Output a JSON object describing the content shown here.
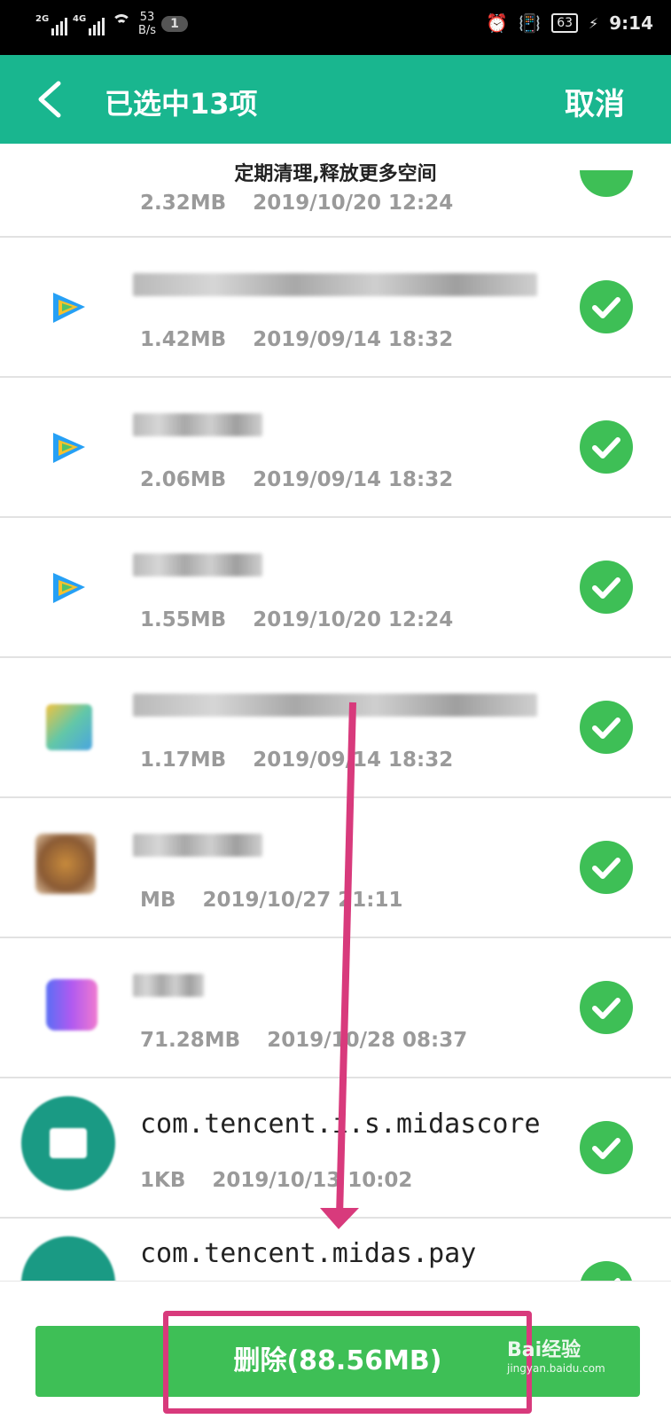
{
  "status_bar": {
    "net1": "2G",
    "net2": "4G",
    "speed_value": "53",
    "speed_unit": "B/s",
    "notification_count": "1",
    "battery": "63",
    "time": "9:14"
  },
  "header": {
    "title": "已选中13项",
    "cancel_label": "取消"
  },
  "list": {
    "banner": "定期清理,释放更多空间",
    "partial_item": {
      "size": "2.32MB",
      "date": "2019/10/20 12:24"
    },
    "items": [
      {
        "name": "",
        "size": "1.42MB",
        "date": "2019/09/14 18:32",
        "icon": "tencent-video-icon"
      },
      {
        "name": "",
        "size": "2.06MB",
        "date": "2019/09/14 18:32",
        "icon": "tencent-video-icon"
      },
      {
        "name": "",
        "size": "1.55MB",
        "date": "2019/10/20 12:24",
        "icon": "tencent-video-icon"
      },
      {
        "name": "",
        "size": "1.17MB",
        "date": "2019/09/14 18:32",
        "icon": "app-icon"
      },
      {
        "name": "",
        "size": "MB",
        "date": "2019/10/27 21:11",
        "icon": "app-icon"
      },
      {
        "name": "",
        "size": "71.28MB",
        "date": "2019/10/28 08:37",
        "icon": "app-icon"
      },
      {
        "name": "com.tencent.i.s.midascore",
        "size": "1KB",
        "date": "2019/10/13 10:02",
        "icon": "android-icon"
      },
      {
        "name": "com.tencent.midas.pay",
        "size": "",
        "date": "",
        "icon": "android-icon"
      }
    ]
  },
  "bottom": {
    "delete_label": "删除(88.56MB)",
    "watermark": "Bai经验",
    "watermark_url": "jingyan.baidu.com"
  },
  "colors": {
    "header": "#19b68f",
    "check": "#3ebf56",
    "annotation": "#d83a7c"
  }
}
